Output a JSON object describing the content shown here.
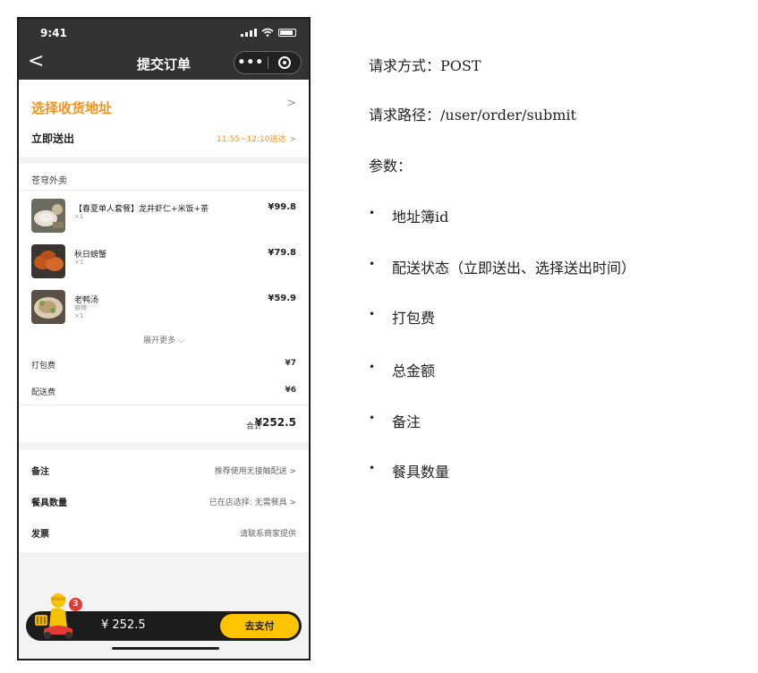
{
  "phone": {
    "status_time": "9:41",
    "nav_title": "提交订单",
    "nav_back": "<",
    "capsule_more": "•••",
    "address": {
      "pick_label": "选择收货地址",
      "deliver_now": "立即送出",
      "eta": "11:55~12:10送达",
      "chevron": ">"
    },
    "shop_name": "苍穹外卖",
    "items": [
      {
        "name": "【春夏单人套餐】龙井虾仁+米饭+茶",
        "sub": "×1",
        "price": "¥99.8"
      },
      {
        "name": "秋日螃蟹",
        "sub": "×1",
        "price": "¥79.8"
      },
      {
        "name": "老鸭汤",
        "sub": "微辣",
        "sub2": "×1",
        "price": "¥59.9"
      }
    ],
    "expand_more": "展开更多 ⌵",
    "packing_fee": {
      "label": "打包费",
      "value": "¥7"
    },
    "delivery_fee": {
      "label": "配送费",
      "value": "¥6"
    },
    "total": {
      "label": "合计",
      "value": "¥252.5"
    },
    "options": [
      {
        "label": "备注",
        "value": "推荐使用无接触配送 >"
      },
      {
        "label": "餐具数量",
        "value": "已在店选择: 无需餐具 >"
      },
      {
        "label": "发票",
        "value": "请联系商家提供"
      }
    ],
    "cart_badge": "3",
    "bottom_amount": "¥ 252.5",
    "pay_button": "去支付"
  },
  "notes": {
    "method": "请求方式：POST",
    "path": "请求路径：/user/order/submit",
    "params_title": "参数：",
    "params": [
      "地址簿id",
      "配送状态（立即送出、选择送出时间）",
      "打包费",
      "总金额",
      "备注",
      "餐具数量"
    ]
  },
  "colors": {
    "accent": "#f5931e",
    "pay": "#ffc400",
    "dark": "#333333"
  }
}
